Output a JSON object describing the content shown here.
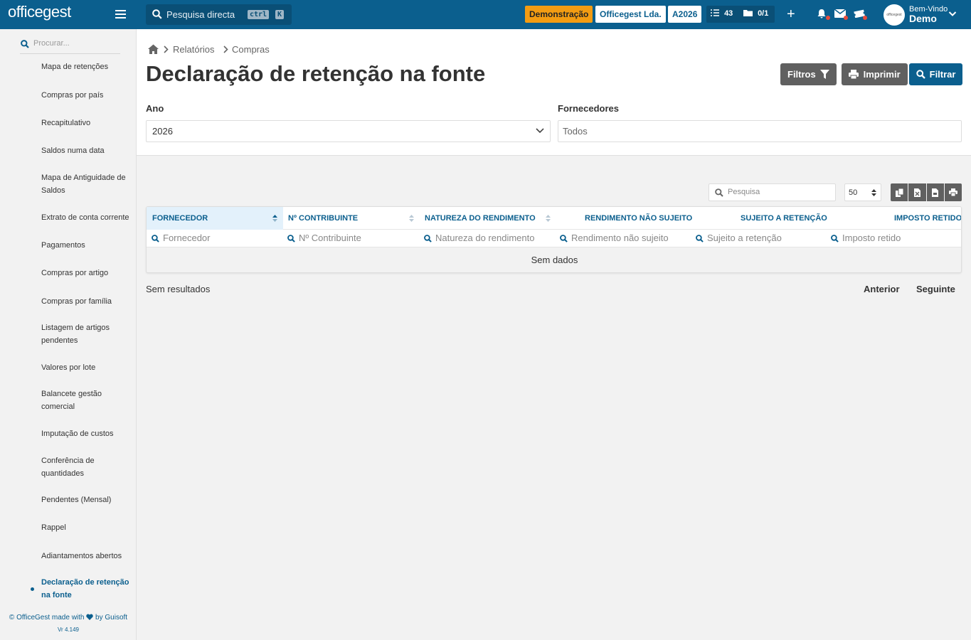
{
  "topbar": {
    "logo": "officegest",
    "search_label": "Pesquisa directa",
    "kbd_ctrl": "ctrl",
    "kbd_k": "K",
    "demo_badge": "Demonstração",
    "company_badge": "Officegest Lda.",
    "year_badge": "A2026",
    "tasks_count": "43",
    "docs_count": "0/1",
    "welcome": "Bem-Vindo",
    "user_name": "Demo",
    "avatar_text": "officegest",
    "brand_color": "#0b5f8e",
    "demo_color": "#f39c12"
  },
  "sidebar": {
    "search_placeholder": "Procurar...",
    "items": [
      {
        "label": "Mapa de retenções"
      },
      {
        "label": "Compras por país"
      },
      {
        "label": "Recapitulativo"
      },
      {
        "label": "Saldos numa data"
      },
      {
        "label": "Mapa de Antiguidade de Saldos"
      },
      {
        "label": "Extrato de conta corrente"
      },
      {
        "label": "Pagamentos"
      },
      {
        "label": "Compras por artigo"
      },
      {
        "label": "Compras por família"
      },
      {
        "label": "Listagem de artigos pendentes"
      },
      {
        "label": "Valores por lote"
      },
      {
        "label": "Balancete gestão comercial"
      },
      {
        "label": "Imputação de custos"
      },
      {
        "label": "Conferência de quantidades"
      },
      {
        "label": "Pendentes (Mensal)"
      },
      {
        "label": "Rappel"
      },
      {
        "label": "Adiantamentos abertos"
      },
      {
        "label": "Declaração de retenção na fonte",
        "active": true
      }
    ],
    "footer_left": "© OfficeGest made with",
    "footer_right": "by Guisoft",
    "version": "Vr 4.149"
  },
  "breadcrumb": {
    "level1": "Relatórios",
    "level2": "Compras"
  },
  "page": {
    "title": "Declaração de retenção na fonte",
    "btn_filters": "Filtros",
    "btn_print": "Imprimir",
    "btn_filter": "Filtrar"
  },
  "form": {
    "year_label": "Ano",
    "year_value": "2026",
    "suppliers_label": "Fornecedores",
    "suppliers_placeholder": "Todos"
  },
  "table": {
    "search_placeholder": "Pesquisa",
    "page_size": "50",
    "columns": [
      {
        "label": "FORNECEDOR",
        "filter_placeholder": "Fornecedor"
      },
      {
        "label": "Nº CONTRIBUINTE",
        "filter_placeholder": "Nº Contribuinte"
      },
      {
        "label": "NATUREZA DO RENDIMENTO",
        "filter_placeholder": "Natureza do rendimento"
      },
      {
        "label": "RENDIMENTO NÃO SUJEITO",
        "filter_placeholder": "Rendimento não sujeito"
      },
      {
        "label": "SUJEITO A RETENÇÃO",
        "filter_placeholder": "Sujeito a retenção"
      },
      {
        "label": "IMPOSTO RETIDO",
        "filter_placeholder": "Imposto retido"
      }
    ],
    "no_data": "Sem dados",
    "results_text": "Sem resultados",
    "prev": "Anterior",
    "next": "Seguinte"
  }
}
